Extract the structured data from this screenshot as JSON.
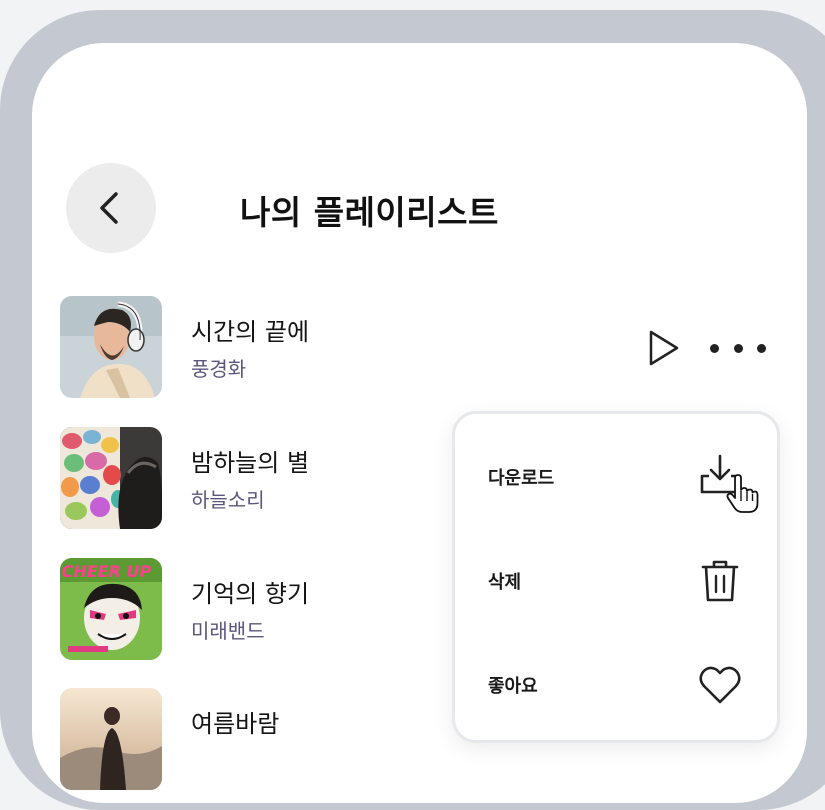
{
  "header": {
    "title": "나의 플레이리스트",
    "back_icon": "chevron-left-icon"
  },
  "tracks": [
    {
      "title": "시간의 끝에",
      "artist": "풍경화",
      "cover": "man-with-headphones-art"
    },
    {
      "title": "밤하늘의 별",
      "artist": "하늘소리",
      "cover": "colorful-mosaic-silhouette-art"
    },
    {
      "title": "기억의 향기",
      "artist": "미래밴드",
      "cover": "cheer-up-punk-poster-art",
      "cover_text": "CHEER UP"
    },
    {
      "title": "여름바람",
      "artist": "",
      "cover": "figure-at-sunset-art"
    }
  ],
  "context_menu": {
    "items": [
      {
        "label": "다운로드",
        "icon": "download-icon"
      },
      {
        "label": "삭제",
        "icon": "trash-icon"
      },
      {
        "label": "좋아요",
        "icon": "heart-icon"
      }
    ]
  },
  "colors": {
    "bezel": "#c4c9d1",
    "screen": "#ffffff",
    "artist_text": "#5c567e",
    "back_button_bg": "#ececec"
  }
}
